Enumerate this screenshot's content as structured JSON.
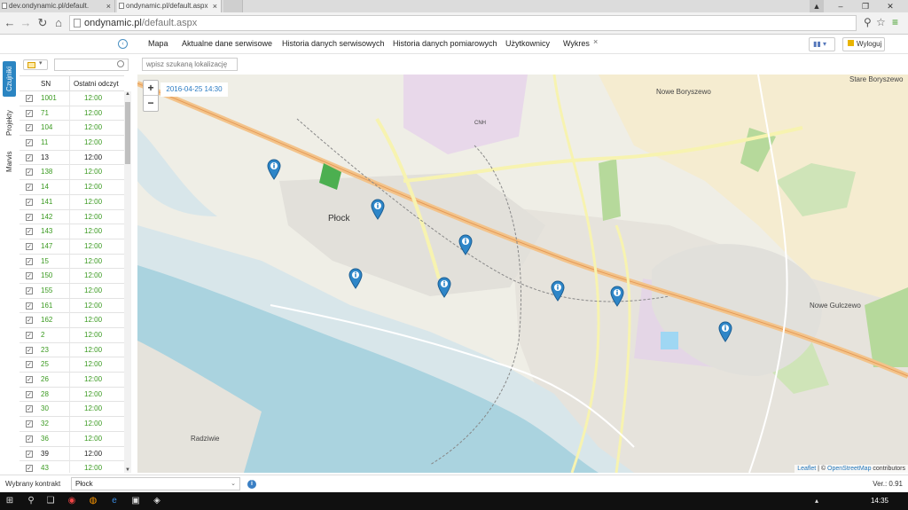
{
  "browser": {
    "tabs": [
      {
        "title": "dev.ondynamic.pl/default."
      },
      {
        "title": "ondynamic.pl/default.aspx"
      }
    ],
    "url_domain": "ondynamic.pl",
    "url_path": "/default.aspx"
  },
  "nav": {
    "items": [
      "Mapa",
      "Aktualne dane serwisowe",
      "Historia danych serwisowych",
      "Historia danych pomiarowych",
      "Użytkownicy",
      "Wykres"
    ],
    "logout_label": "Wyloguj"
  },
  "side_tabs": [
    "Czujniki",
    "Projekty",
    "Marvis"
  ],
  "table": {
    "col_sn": "SN",
    "col_last": "Ostatni odczyt",
    "rows": [
      {
        "sn": "1001",
        "time": "12:00",
        "ok": true
      },
      {
        "sn": "71",
        "time": "12:00",
        "ok": true
      },
      {
        "sn": "104",
        "time": "12:00",
        "ok": true
      },
      {
        "sn": "11",
        "time": "12:00",
        "ok": true
      },
      {
        "sn": "13",
        "time": "12:00",
        "ok": false
      },
      {
        "sn": "138",
        "time": "12:00",
        "ok": true
      },
      {
        "sn": "14",
        "time": "12:00",
        "ok": true
      },
      {
        "sn": "141",
        "time": "12:00",
        "ok": true
      },
      {
        "sn": "142",
        "time": "12:00",
        "ok": true
      },
      {
        "sn": "143",
        "time": "12:00",
        "ok": true
      },
      {
        "sn": "147",
        "time": "12:00",
        "ok": true
      },
      {
        "sn": "15",
        "time": "12:00",
        "ok": true
      },
      {
        "sn": "150",
        "time": "12:00",
        "ok": true
      },
      {
        "sn": "155",
        "time": "12:00",
        "ok": true
      },
      {
        "sn": "161",
        "time": "12:00",
        "ok": true
      },
      {
        "sn": "162",
        "time": "12:00",
        "ok": true
      },
      {
        "sn": "2",
        "time": "12:00",
        "ok": true
      },
      {
        "sn": "23",
        "time": "12:00",
        "ok": true
      },
      {
        "sn": "25",
        "time": "12:00",
        "ok": true
      },
      {
        "sn": "26",
        "time": "12:00",
        "ok": true
      },
      {
        "sn": "28",
        "time": "12:00",
        "ok": true
      },
      {
        "sn": "30",
        "time": "12:00",
        "ok": true
      },
      {
        "sn": "32",
        "time": "12:00",
        "ok": true
      },
      {
        "sn": "36",
        "time": "12:00",
        "ok": true
      },
      {
        "sn": "39",
        "time": "12:00",
        "ok": false
      },
      {
        "sn": "43",
        "time": "12:00",
        "ok": true
      }
    ]
  },
  "map": {
    "search_placeholder": "wpisz szukaną lokalizację",
    "date_label": "2016-04-25 14:30",
    "zoom_in": "+",
    "zoom_out": "−",
    "places": {
      "plock": "Płock",
      "nowe_boryszewo": "Nowe Boryszewo",
      "stare_boryszewo": "Stare Boryszewo",
      "nowe_gulczewo": "Nowe Gulczewo",
      "radziwie": "Radziwie",
      "cnh": "CNH"
    },
    "attribution_leaflet": "Leaflet",
    "attribution_sep": " | © ",
    "attribution_osm": "OpenStreetMap",
    "attribution_rest": " contributors"
  },
  "status": {
    "contract_label": "Wybrany kontrakt",
    "contract_value": "Płock",
    "version": "Ver.: 0.91"
  },
  "taskbar": {
    "time": "14:35"
  },
  "colors": {
    "accent": "#2b85c2",
    "ok_green": "#3a9a20",
    "marker_blue": "#2e86c8"
  }
}
